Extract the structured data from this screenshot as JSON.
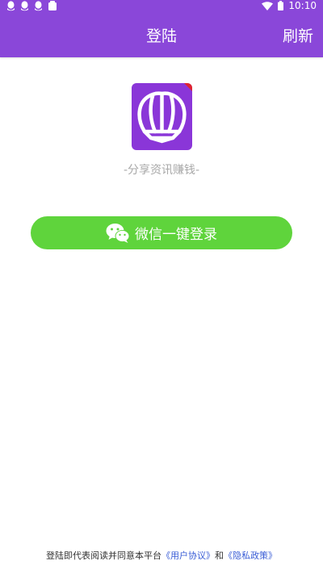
{
  "status_bar": {
    "time": "10:10",
    "icons": [
      "qq-icon",
      "qq-icon",
      "qq-icon",
      "notification-icon",
      "wifi-icon",
      "battery-icon"
    ]
  },
  "header": {
    "title": "登陆",
    "refresh_label": "刷新",
    "background_color": "#8a47d9"
  },
  "app": {
    "logo_icon": "shell-icon",
    "slogan": "-分享资讯赚钱-"
  },
  "login": {
    "wechat_label": "微信一键登录",
    "button_color": "#5fd43c"
  },
  "agreement": {
    "prefix": "登陆即代表阅读并同意本平台",
    "user_agreement": "《用户协议》",
    "conjunction": "和",
    "privacy_policy": "《隐私政策》",
    "link_color": "#3a5dd6"
  }
}
